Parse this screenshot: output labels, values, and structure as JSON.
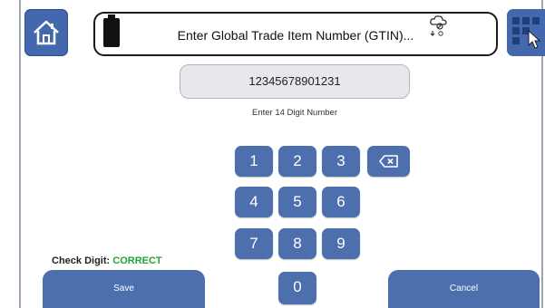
{
  "header": {
    "title": "Enter Global Trade Item Number (GTIN)...",
    "home_icon": "home-icon",
    "battery_icon": "battery-icon",
    "cloud_icon": "cloud-sync-icon",
    "grid_icon": "grid-menu-icon"
  },
  "gtin": {
    "value": "12345678901231",
    "hint": "Enter 14 Digit Number"
  },
  "keypad": {
    "keys": [
      "1",
      "2",
      "3",
      "4",
      "5",
      "6",
      "7",
      "8",
      "9",
      "0"
    ],
    "backspace_icon": "backspace-icon"
  },
  "check_digit": {
    "label": "Check Digit:",
    "status": "CORRECT",
    "status_color": "#21a336"
  },
  "actions": {
    "save_label": "Save",
    "cancel_label": "Cancel"
  },
  "colors": {
    "accent": "#4d6fae",
    "header_button": "#4468ad"
  }
}
